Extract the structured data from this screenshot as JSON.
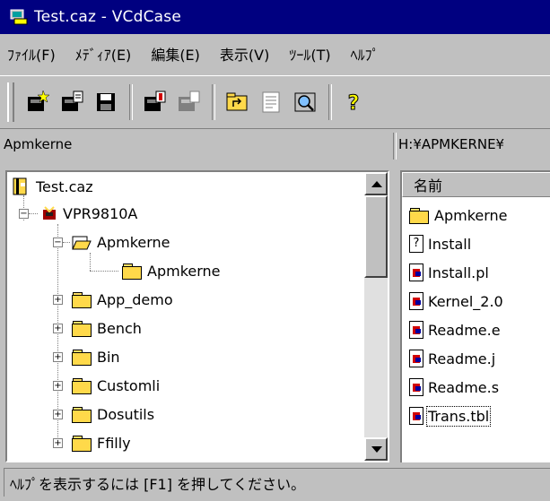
{
  "window": {
    "title": "Test.caz - VCdCase"
  },
  "menubar": {
    "items": [
      "ﾌｧｲﾙ(F)",
      "ﾒﾃﾞｨｱ(E)",
      "編集(E)",
      "表示(V)",
      "ﾂｰﾙ(T)",
      "ﾍﾙﾌﾟ"
    ]
  },
  "toolbar": {
    "buttons": [
      "new-icon",
      "open-icon",
      "save-icon",
      "add-media-icon",
      "remove-media-icon",
      "folder-up-icon",
      "properties-icon",
      "search-icon",
      "help-icon"
    ],
    "help_glyph": "?"
  },
  "pathbar": {
    "left": "Apmkerne",
    "right": "H:¥APMKERNE¥"
  },
  "tree": {
    "items": [
      {
        "label": "Test.caz",
        "icon": "catalog-icon"
      },
      {
        "label": "VPR9810A",
        "icon": "media-icon"
      },
      {
        "label": "Apmkerne",
        "icon": "open-folder-icon"
      },
      {
        "label": "Apmkerne",
        "icon": "folder-icon"
      },
      {
        "label": "App_demo",
        "icon": "folder-icon"
      },
      {
        "label": "Bench",
        "icon": "folder-icon"
      },
      {
        "label": "Bin",
        "icon": "folder-icon"
      },
      {
        "label": "Customli",
        "icon": "folder-icon"
      },
      {
        "label": "Dosutils",
        "icon": "folder-icon"
      },
      {
        "label": "Ffilly",
        "icon": "folder-icon"
      }
    ],
    "expand_glyph": "+",
    "collapse_glyph": "−"
  },
  "filelist": {
    "header": "名前",
    "items": [
      {
        "label": "Apmkerne",
        "icon": "folder-icon"
      },
      {
        "label": "Install",
        "icon": "unknown-file-icon"
      },
      {
        "label": "Install.pl",
        "icon": "script-file-icon"
      },
      {
        "label": "Kernel_2.0",
        "icon": "script-file-icon"
      },
      {
        "label": "Readme.e",
        "icon": "script-file-icon"
      },
      {
        "label": "Readme.j",
        "icon": "script-file-icon"
      },
      {
        "label": "Readme.s",
        "icon": "script-file-icon"
      },
      {
        "label": "Trans.tbl",
        "icon": "script-file-icon"
      }
    ],
    "unknown_glyph": "?"
  },
  "statusbar": {
    "text": "ﾍﾙﾌﾟを表示するには [F1] を押してください。"
  },
  "colors": {
    "titlebar": "#000080",
    "chrome": "#c0c0c0",
    "folder": "#ffd94a"
  }
}
